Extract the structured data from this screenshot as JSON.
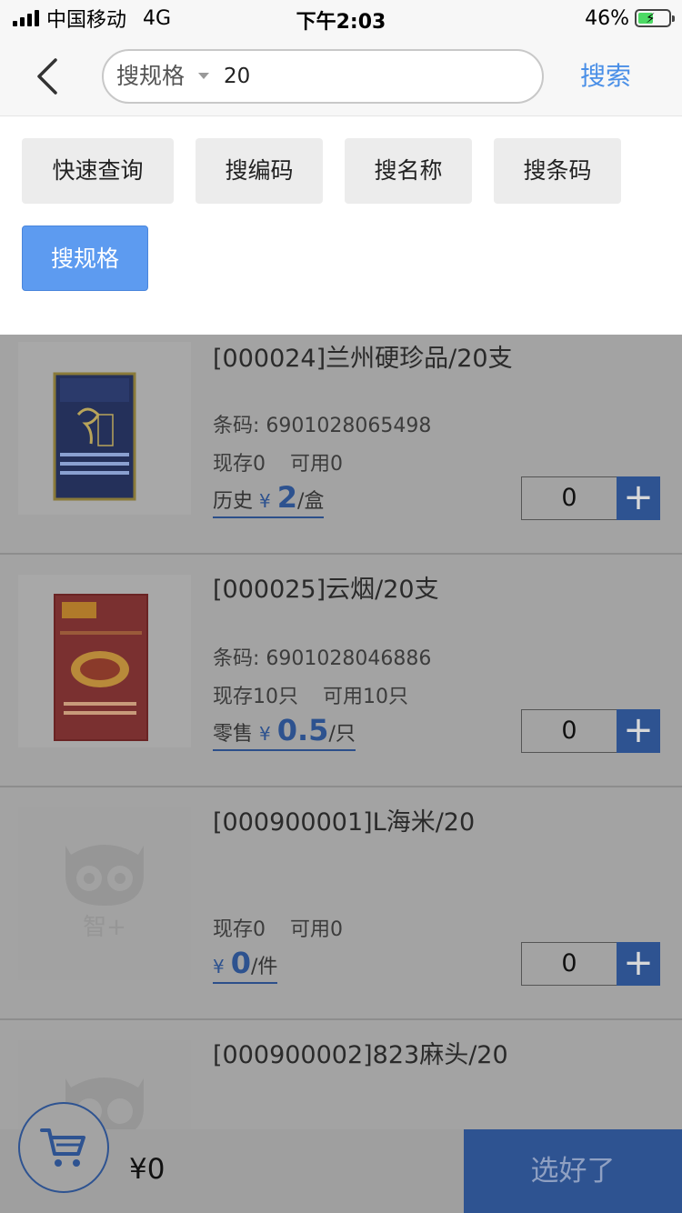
{
  "status_bar": {
    "carrier": "中国移动",
    "network": "4G",
    "time": "下午2:03",
    "battery": "46%"
  },
  "nav": {
    "search_type": "搜规格",
    "search_value": "20",
    "search_button": "搜索"
  },
  "filters": [
    {
      "label": "快速查询",
      "active": false
    },
    {
      "label": "搜编码",
      "active": false
    },
    {
      "label": "搜名称",
      "active": false
    },
    {
      "label": "搜条码",
      "active": false
    },
    {
      "label": "搜规格",
      "active": true
    }
  ],
  "products": [
    {
      "title": "[000024]兰州硬珍品/20支",
      "barcode": "条码: 6901028065498",
      "stock": "现存0",
      "available": "可用0",
      "price_label": "历史",
      "currency": "¥",
      "price": "2",
      "unit": "/盒",
      "qty": "0",
      "image": "lanzhou-pack"
    },
    {
      "title": "[000025]云烟/20支",
      "barcode": "条码: 6901028046886",
      "stock": "现存10只",
      "available": "可用10只",
      "price_label": "零售",
      "currency": "¥",
      "price": "0.5",
      "unit": "/只",
      "qty": "0",
      "image": "yunyan-pack"
    },
    {
      "title": "[000900001]L海米/20",
      "barcode": "",
      "stock": "现存0",
      "available": "可用0",
      "price_label": "",
      "currency": "¥",
      "price": "0",
      "unit": "/件",
      "qty": "0",
      "image": "owl-placeholder"
    },
    {
      "title": "[000900002]823麻头/20",
      "image": "owl-placeholder"
    }
  ],
  "placeholder_logo_text": "智+",
  "bottom": {
    "total": "¥0",
    "done_button": "选好了"
  },
  "colors": {
    "accent": "#4a8fe7",
    "active_chip": "#5d9bf0",
    "overlay_blue": "#2e5391"
  }
}
